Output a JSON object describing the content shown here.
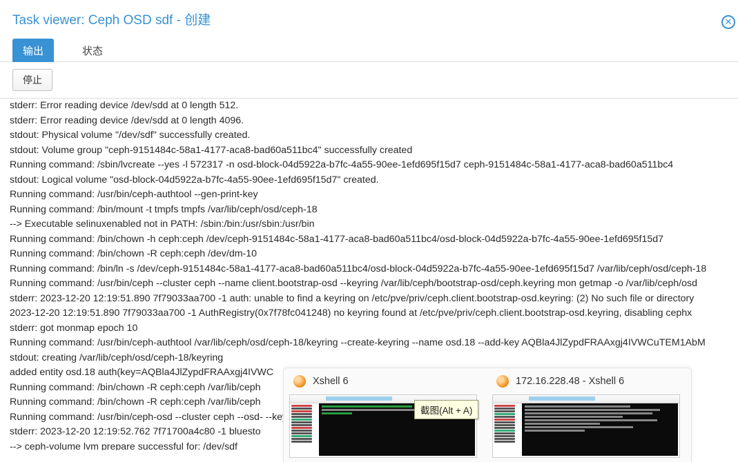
{
  "window": {
    "title": "Task viewer: Ceph OSD sdf - 创建"
  },
  "tabs": {
    "output": "输出",
    "status": "状态"
  },
  "toolbar": {
    "stop": "停止"
  },
  "log": {
    "lines": [
      " stderr: Error reading device /dev/sdd at 0 length 512.",
      " stderr: Error reading device /dev/sdd at 0 length 4096.",
      " stdout: Physical volume \"/dev/sdf\" successfully created.",
      " stdout: Volume group \"ceph-9151484c-58a1-4177-aca8-bad60a511bc4\" successfully created",
      "Running command: /sbin/lvcreate --yes -l 572317 -n osd-block-04d5922a-b7fc-4a55-90ee-1efd695f15d7 ceph-9151484c-58a1-4177-aca8-bad60a511bc4",
      " stdout: Logical volume \"osd-block-04d5922a-b7fc-4a55-90ee-1efd695f15d7\" created.",
      "Running command: /usr/bin/ceph-authtool --gen-print-key",
      "Running command: /bin/mount -t tmpfs tmpfs /var/lib/ceph/osd/ceph-18",
      "--> Executable selinuxenabled not in PATH: /sbin:/bin:/usr/sbin:/usr/bin",
      "Running command: /bin/chown -h ceph:ceph /dev/ceph-9151484c-58a1-4177-aca8-bad60a511bc4/osd-block-04d5922a-b7fc-4a55-90ee-1efd695f15d7",
      "Running command: /bin/chown -R ceph:ceph /dev/dm-10",
      "Running command: /bin/ln -s /dev/ceph-9151484c-58a1-4177-aca8-bad60a511bc4/osd-block-04d5922a-b7fc-4a55-90ee-1efd695f15d7 /var/lib/ceph/osd/ceph-18",
      "Running command: /usr/bin/ceph --cluster ceph --name client.bootstrap-osd --keyring /var/lib/ceph/bootstrap-osd/ceph.keyring mon getmap -o /var/lib/ceph/osd",
      " stderr: 2023-12-20 12:19:51.890 7f79033aa700 -1 auth: unable to find a keyring on /etc/pve/priv/ceph.client.bootstrap-osd.keyring: (2) No such file or directory",
      "2023-12-20 12:19:51.890 7f79033aa700 -1 AuthRegistry(0x7f78fc041248) no keyring found at /etc/pve/priv/ceph.client.bootstrap-osd.keyring, disabling cephx",
      " stderr: got monmap epoch 10",
      "Running command: /usr/bin/ceph-authtool /var/lib/ceph/osd/ceph-18/keyring --create-keyring --name osd.18 --add-key AQBla4JlZypdFRAAxgj4IVWCuTEM1AbM",
      " stdout: creating /var/lib/ceph/osd/ceph-18/keyring",
      "added entity osd.18 auth(key=AQBla4JlZypdFRAAxgj4IVWC",
      "Running command: /bin/chown -R ceph:ceph /var/lib/ceph",
      "Running command: /bin/chown -R ceph:ceph /var/lib/ceph",
      "Running command: /usr/bin/ceph-osd --cluster ceph --osd-                                                                                                                                                                                                                                                                                                                  --keyfile - -",
      " stderr: 2023-12-20 12:19:52.762 7f71700a4c80 -1 bluesto",
      "--> ceph-volume lvm prepare successful for: /dev/sdf"
    ]
  },
  "thumbs": [
    {
      "label": "Xshell 6"
    },
    {
      "label": "172.16.228.48 - Xshell 6"
    }
  ],
  "tooltip": "截图(Alt + A)"
}
